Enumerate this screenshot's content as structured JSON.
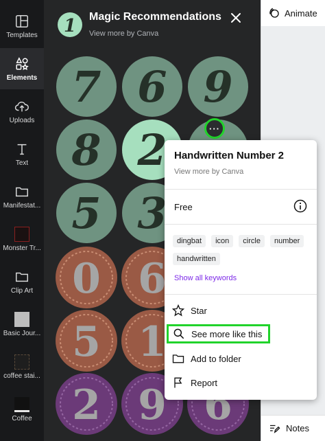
{
  "sidebar": {
    "items": [
      {
        "label": "Templates",
        "icon": "templates-icon",
        "active": false
      },
      {
        "label": "Elements",
        "icon": "elements-icon",
        "active": true
      },
      {
        "label": "Uploads",
        "icon": "upload-icon",
        "active": false
      },
      {
        "label": "Text",
        "icon": "text-icon",
        "active": false
      },
      {
        "label": "Manifestat...",
        "icon": "folder-icon",
        "active": false
      },
      {
        "label": "Monster Tr...",
        "icon": "thumbnail-icon",
        "active": false
      },
      {
        "label": "Clip Art",
        "icon": "folder-icon",
        "active": false
      },
      {
        "label": "Basic Jour...",
        "icon": "thumbnail-icon",
        "active": false
      },
      {
        "label": "coffee stai...",
        "icon": "thumbnail-icon",
        "active": false
      },
      {
        "label": "Coffee",
        "icon": "thumbnail-icon",
        "active": false
      }
    ]
  },
  "panel": {
    "title": "Magic Recommendations",
    "subtitle": "View more by Canva",
    "badge_number": "1",
    "numbers": [
      "7",
      "6",
      "9",
      "8",
      "2",
      "",
      "5",
      "3",
      "",
      "0",
      "6",
      "",
      "5",
      "1",
      "",
      "2",
      "9",
      "6"
    ],
    "more_label": "···"
  },
  "toolbar": {
    "animate_label": "Animate",
    "notes_label": "Notes"
  },
  "popup": {
    "title": "Handwritten Number 2",
    "subtitle": "View more by Canva",
    "license": "Free",
    "keywords": [
      "dingbat",
      "icon",
      "circle",
      "number",
      "handwritten"
    ],
    "show_keywords": "Show all keywords",
    "menu": [
      {
        "label": "Star",
        "icon": "star-icon"
      },
      {
        "label": "See more like this",
        "icon": "search-icon"
      },
      {
        "label": "Add to folder",
        "icon": "folder-icon"
      },
      {
        "label": "Report",
        "icon": "flag-icon"
      }
    ]
  },
  "colors": {
    "sage": "#6f9381",
    "mint": "#a6dfbe",
    "copper": "#9a5a45",
    "purple": "#6b3a78",
    "highlight": "#21d32b",
    "link": "#7d2ae8"
  }
}
